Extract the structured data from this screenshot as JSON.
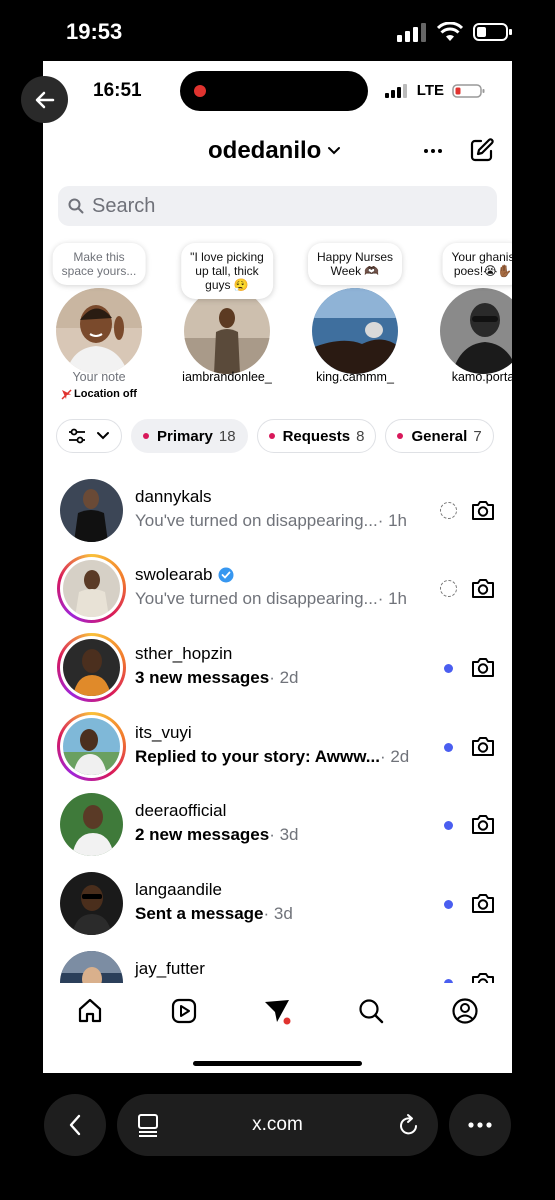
{
  "device": {
    "time": "19:53"
  },
  "app": {
    "time": "16:51",
    "network": "LTE",
    "account": "odedanilo",
    "search_placeholder": "Search",
    "notes": [
      {
        "bubble": "Make this\nspace yours...",
        "label": "Your note",
        "sub": "Location off"
      },
      {
        "bubble": "\"I love picking\nup tall, thick\nguys 😮‍💨",
        "label": "iambrandonlee_"
      },
      {
        "bubble": "Happy Nurses\nWeek 🫶🏿",
        "label": "king.cammm_"
      },
      {
        "bubble": "Your ghanis\npoes!😭✋🏾",
        "label": "kamo.porta"
      }
    ],
    "filters": [
      {
        "label": "Primary",
        "count": "18"
      },
      {
        "label": "Requests",
        "count": "8"
      },
      {
        "label": "General",
        "count": "7"
      }
    ],
    "messages": [
      {
        "name": "dannykals",
        "preview": "You've turned on disappearing...",
        "time": " · 1h",
        "unread": false
      },
      {
        "name": "swolearab",
        "preview": "You've turned on disappearing...",
        "time": " · 1h",
        "unread": false,
        "verified": true
      },
      {
        "name": "sther_hopzin",
        "preview": "3 new messages",
        "time": " · 2d",
        "unread": true
      },
      {
        "name": "its_vuyi",
        "preview": "Replied to your story: Awww...",
        "time": " · 2d",
        "unread": true
      },
      {
        "name": "deeraofficial",
        "preview": "2 new messages",
        "time": " · 3d",
        "unread": true
      },
      {
        "name": "langaandile",
        "preview": "Sent a message",
        "time": " · 3d",
        "unread": true
      },
      {
        "name": "jay_futter",
        "preview": "",
        "time": "",
        "unread": true
      }
    ],
    "nav": [
      "home-icon",
      "reels-icon",
      "direct-icon",
      "search-icon",
      "profile-icon"
    ]
  },
  "browser": {
    "url": "x.com"
  },
  "colors": {
    "accent_dot": "#d8185a",
    "unread_dot": "#4a5ef0",
    "verified": "#3797f0",
    "location": "#e0332f"
  }
}
